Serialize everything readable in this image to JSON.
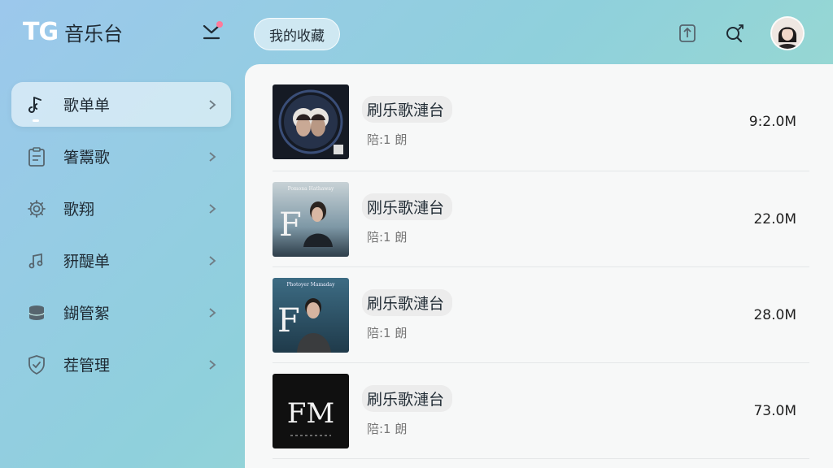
{
  "app": {
    "logo_mark": "TG",
    "logo_text": "音乐台"
  },
  "sidebar": {
    "items": [
      {
        "label": "歌单单",
        "icon": "music-note-icon",
        "active": true
      },
      {
        "label": "箸鬻歌",
        "icon": "clipboard-icon",
        "active": false
      },
      {
        "label": "歌翔",
        "icon": "gear-icon",
        "active": false
      },
      {
        "label": "豜醍单",
        "icon": "playlist-note-icon",
        "active": false
      },
      {
        "label": "鍸管絮",
        "icon": "database-icon",
        "active": false
      },
      {
        "label": "茬管理",
        "icon": "shield-icon",
        "active": false
      }
    ]
  },
  "header": {
    "tab_label": "我的收藏",
    "icons": [
      "upload-icon",
      "search-icon"
    ]
  },
  "list": {
    "rows": [
      {
        "title": "刷乐歌漣台",
        "subtitle": "陪:1 朗",
        "size": "9:2.0M",
        "cover": "circle-art"
      },
      {
        "title": "刚乐歌漣台",
        "subtitle": "陪:1 朗",
        "size": "22.0M",
        "cover": "portrait-side"
      },
      {
        "title": "刷乐歌漣台",
        "subtitle": "陪:1 朗",
        "size": "28.0M",
        "cover": "portrait-front"
      },
      {
        "title": "刷乐歌漣台",
        "subtitle": "陪:1 朗",
        "size": "73.0M",
        "cover": "fm-dark"
      }
    ],
    "cover_texts": {
      "circle": "",
      "portrait_side": "Pomona Hathaway",
      "portrait_front": "Photoyer Mamaday",
      "fm": "FM"
    }
  },
  "colors": {
    "accent_pink": "#ff7a9a",
    "sidebar_text": "#1f2a33",
    "main_bg": "#f7f8f8"
  }
}
